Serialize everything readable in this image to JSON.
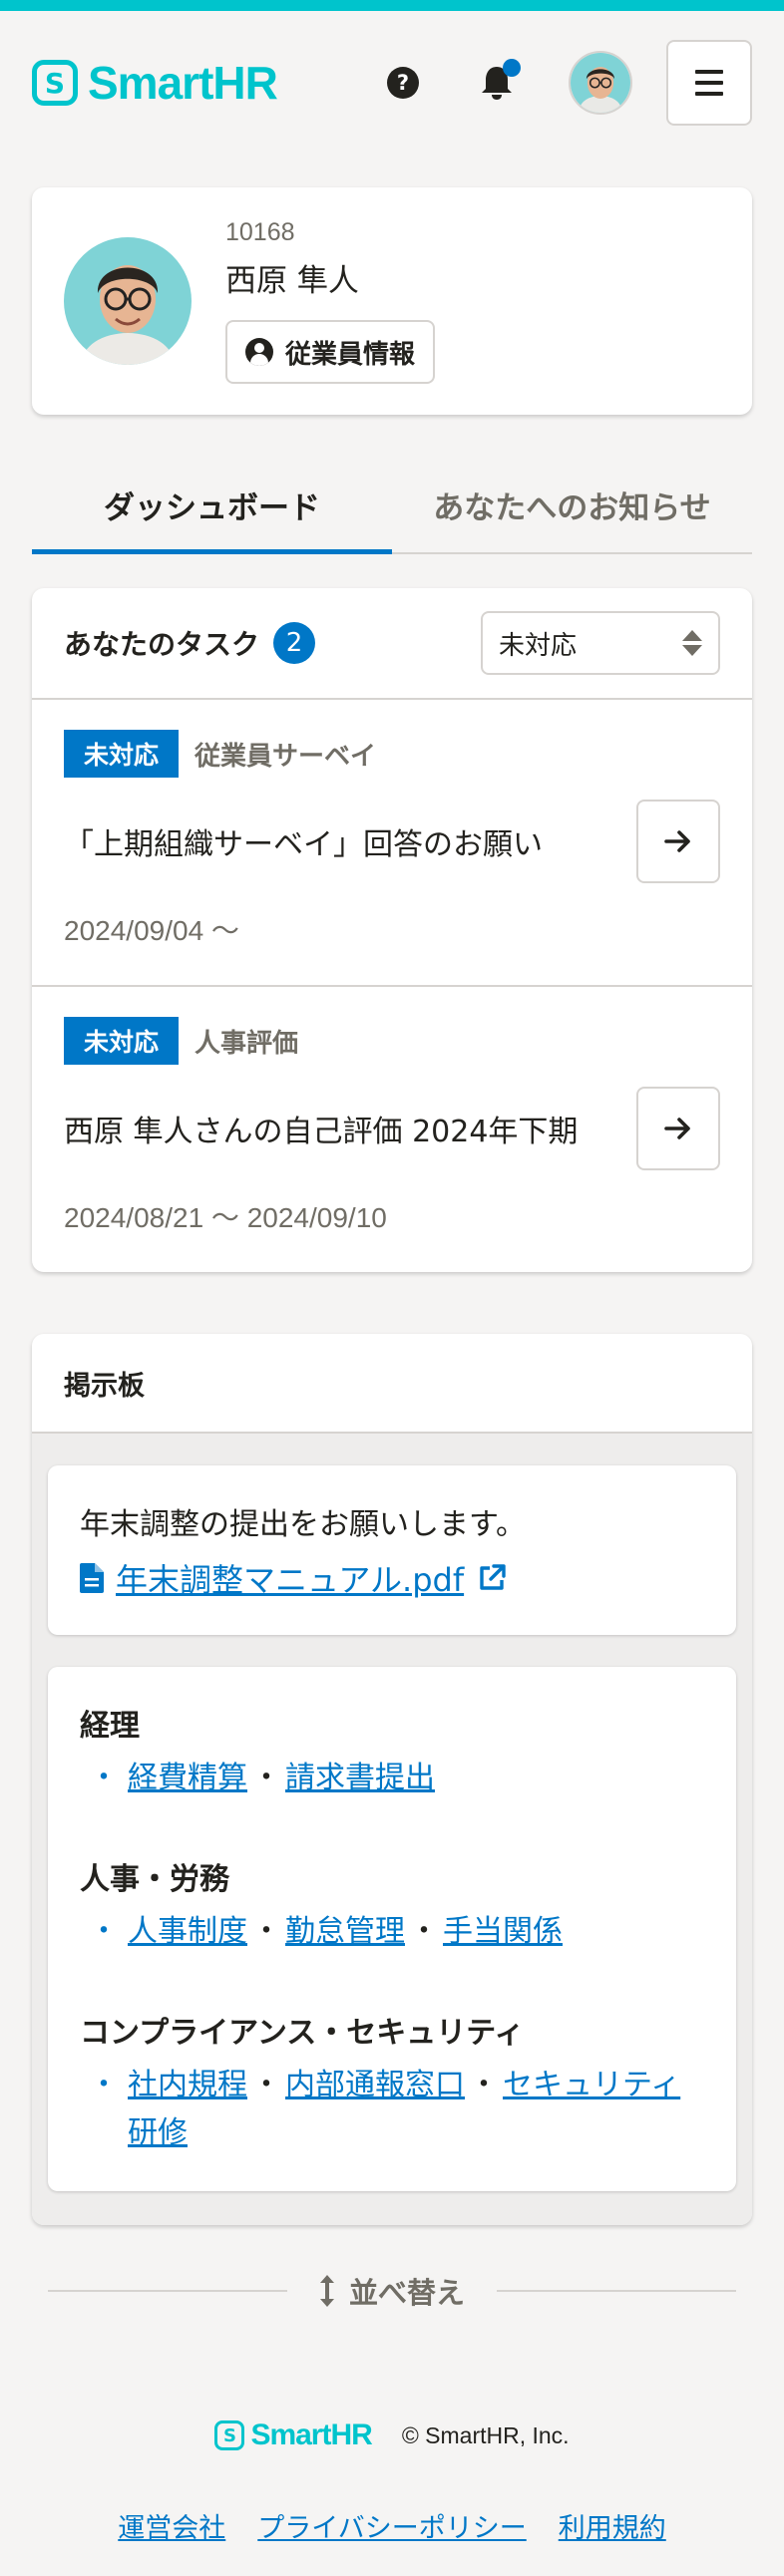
{
  "header": {
    "brand": "SmartHR",
    "logo_mark": "S",
    "help_icon_glyph": "?",
    "icons": [
      "help-icon",
      "bell-icon",
      "avatar",
      "hamburger-menu-icon"
    ],
    "notification_dot": true
  },
  "profile": {
    "employee_number": "10168",
    "name": "西原 隼人",
    "employee_info_button": "従業員情報"
  },
  "tabs": [
    {
      "label": "ダッシュボード",
      "active": true
    },
    {
      "label": "あなたへのお知らせ",
      "active": false
    }
  ],
  "tasks": {
    "title": "あなたのタスク",
    "count": "2",
    "filter_selected": "未対応",
    "items": [
      {
        "status": "未対応",
        "category": "従業員サーベイ",
        "title": "「上期組織サーベイ」回答のお願い",
        "date": "2024/09/04 〜"
      },
      {
        "status": "未対応",
        "category": "人事評価",
        "title": "西原 隼人さんの自己評価 2024年下期",
        "date": "2024/08/21 〜 2024/09/10"
      }
    ]
  },
  "board": {
    "title": "掲示板",
    "notice": {
      "text": "年末調整の提出をお願いします。",
      "link": "年末調整マニュアル.pdf"
    },
    "groups": [
      {
        "title": "経理",
        "links": [
          "経費精算",
          "請求書提出"
        ]
      },
      {
        "title": "人事・労務",
        "links": [
          "人事制度",
          "勤怠管理",
          "手当関係"
        ]
      },
      {
        "title": "コンプライアンス・セキュリティ",
        "links": [
          "社内規程",
          "内部通報窓口",
          "セキュリティ研修"
        ]
      }
    ],
    "bullet": "・",
    "separator": "・"
  },
  "reorder_button": "並べ替え",
  "footer": {
    "brand": "SmartHR",
    "copyright": "© SmartHR, Inc.",
    "links": [
      "運営会社",
      "プライバシーポリシー",
      "利用規約"
    ]
  },
  "colors": {
    "brand": "#00c4cc",
    "accent": "#0077c7",
    "text": "#23221e",
    "muted": "#706d65",
    "background": "#f5f4f3"
  }
}
